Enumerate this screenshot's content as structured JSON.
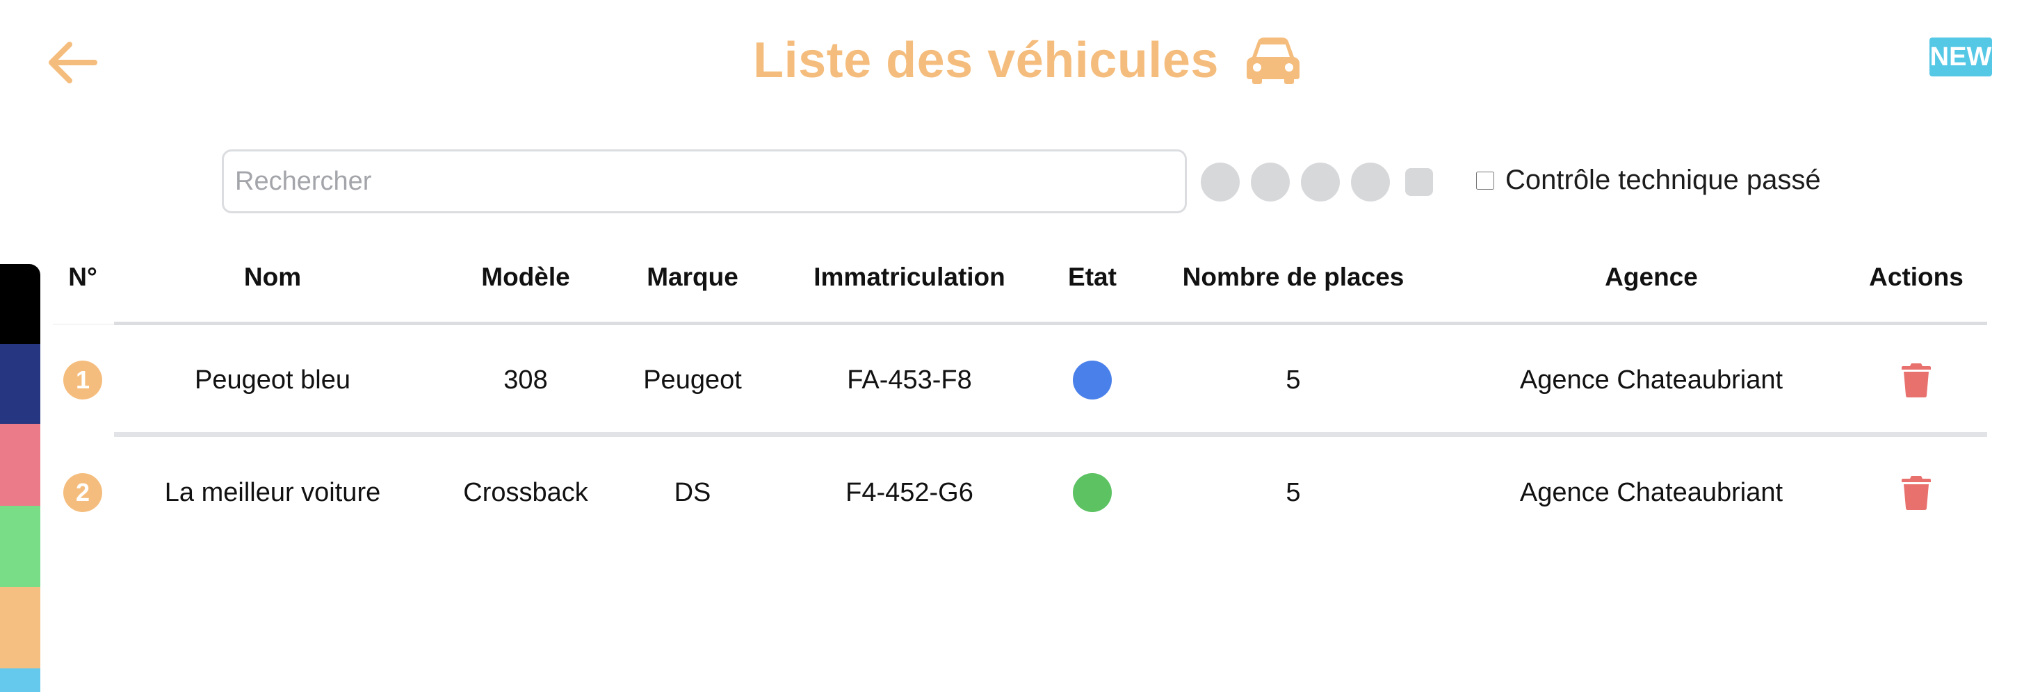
{
  "header": {
    "title": "Liste des véhicules",
    "new_badge": "NEW",
    "title_icon": "car-icon",
    "back_icon": "arrow-left-icon"
  },
  "filters": {
    "search_placeholder": "Rechercher",
    "search_value": "",
    "color_filter_count": 5,
    "controle_label": "Contrôle technique passé",
    "controle_checked": false
  },
  "side_colors": [
    "#000000",
    "#263680",
    "#ec7b8a",
    "#79dc86",
    "#f5bf82",
    "#64c9ec"
  ],
  "table": {
    "headers": {
      "num": "N°",
      "nom": "Nom",
      "modele": "Modèle",
      "marque": "Marque",
      "immatriculation": "Immatriculation",
      "etat": "Etat",
      "places": "Nombre de places",
      "agence": "Agence",
      "actions": "Actions"
    },
    "rows": [
      {
        "num": "1",
        "nom": "Peugeot bleu",
        "modele": "308",
        "marque": "Peugeot",
        "immatriculation": "FA-453-F8",
        "etat_color": "#4a80ea",
        "places": "5",
        "agence": "Agence Chateaubriant"
      },
      {
        "num": "2",
        "nom": "La meilleur voiture",
        "modele": "Crossback",
        "marque": "DS",
        "immatriculation": "F4-452-G6",
        "etat_color": "#5cc262",
        "places": "5",
        "agence": "Agence Chateaubriant"
      }
    ]
  },
  "colors": {
    "accent": "#f5bd7d",
    "new_badge": "#55c8e6",
    "delete": "#e8716e"
  }
}
